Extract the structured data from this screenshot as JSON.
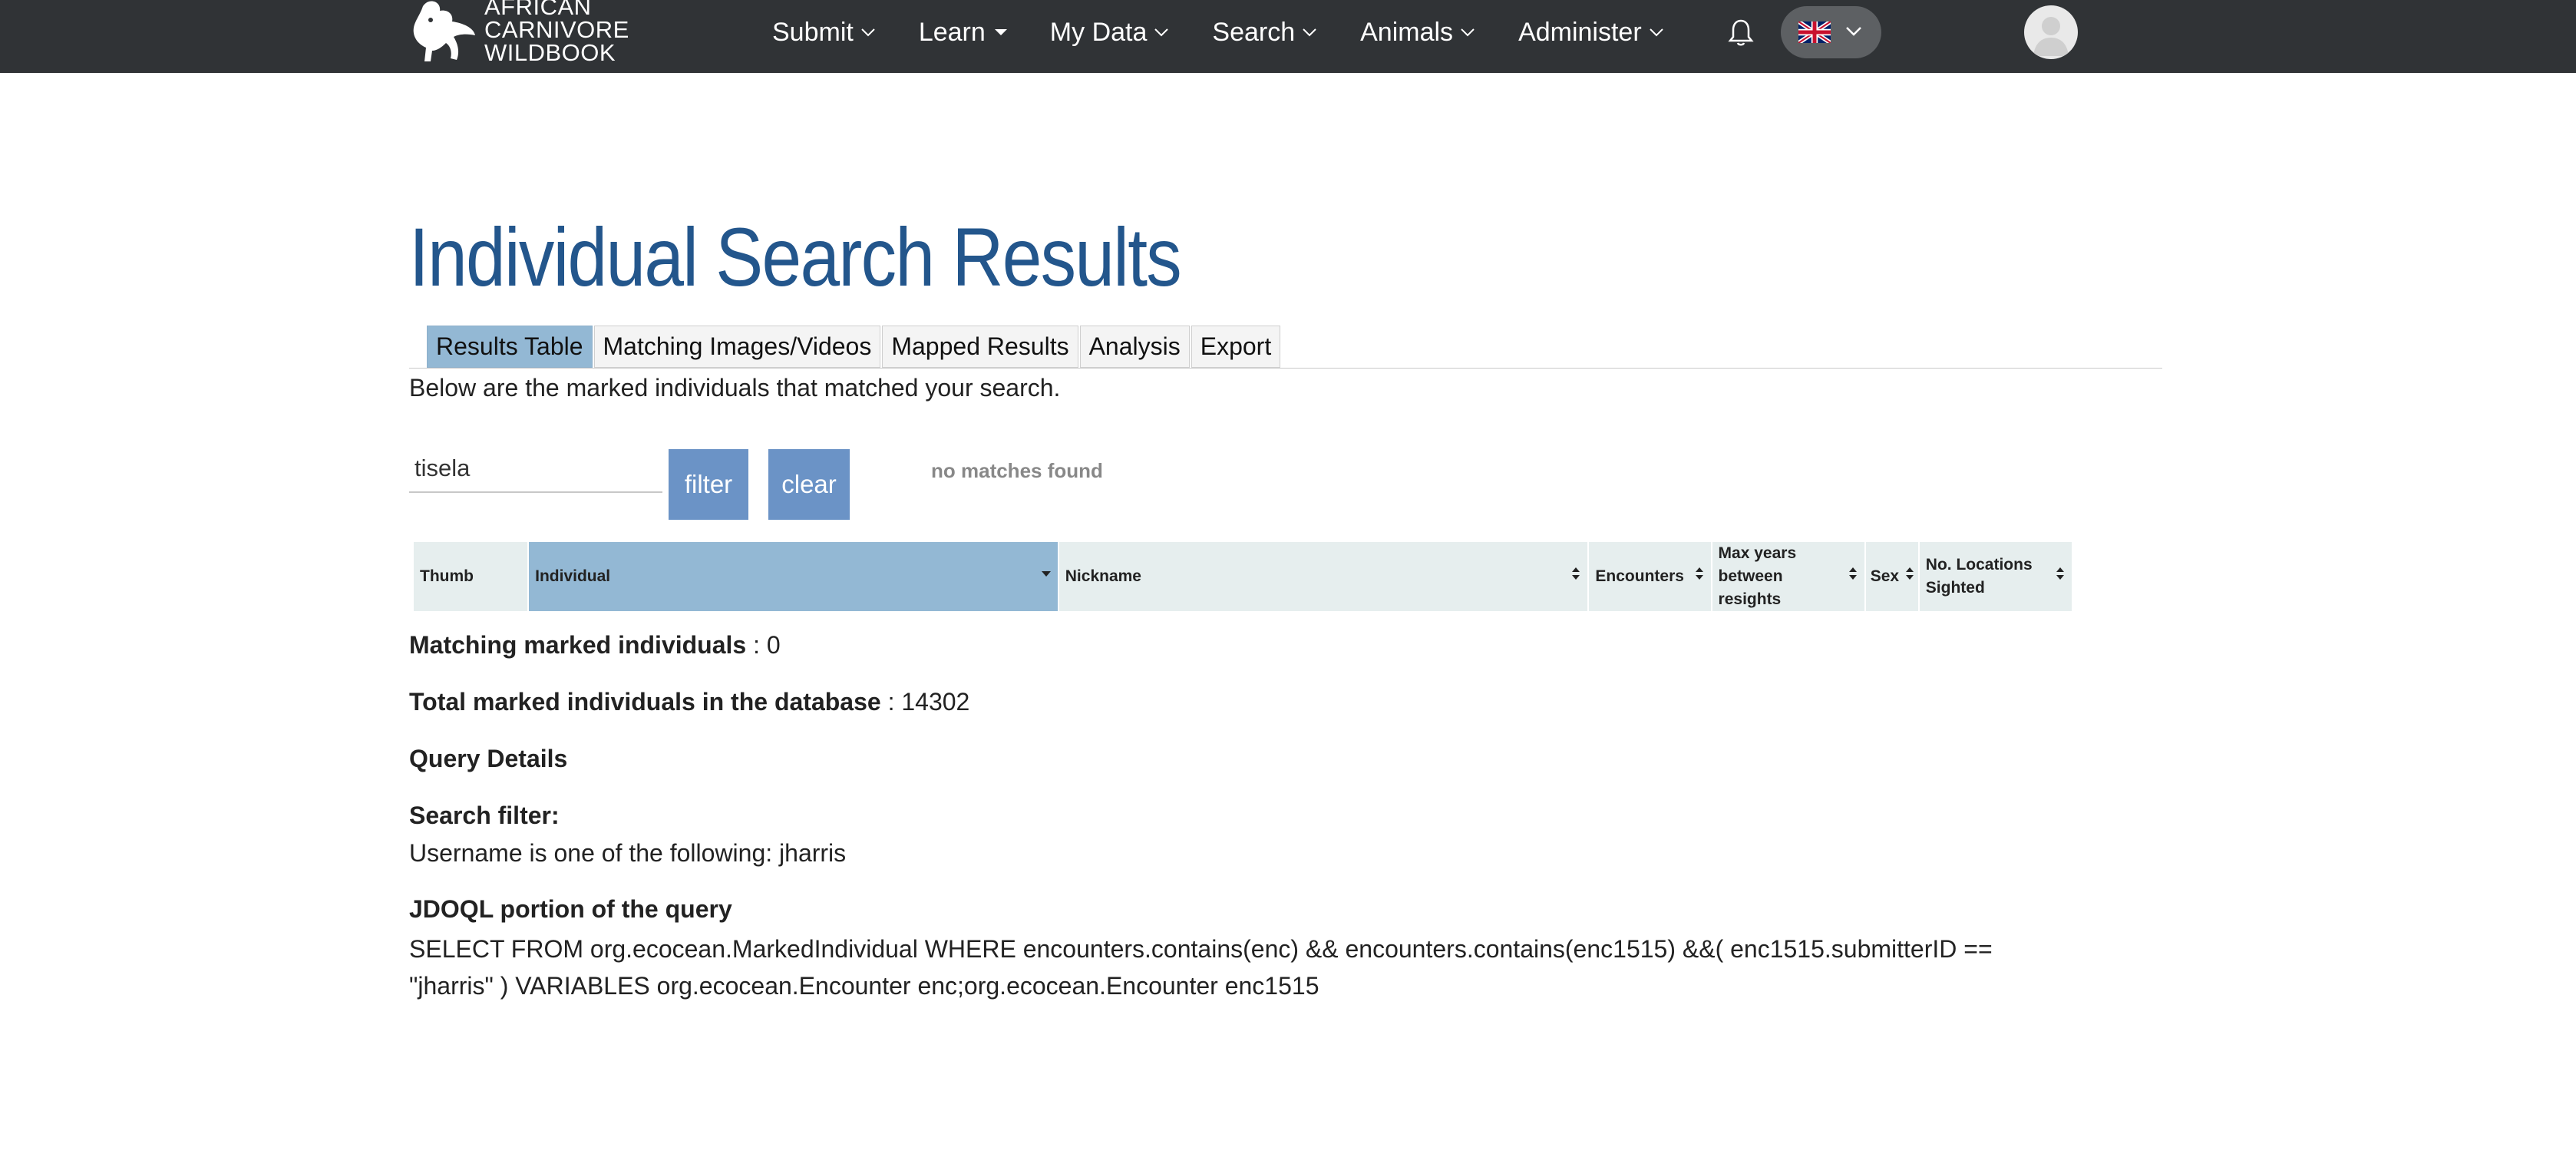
{
  "brand": {
    "line1": "AFRICAN",
    "line2": "CARNIVORE",
    "line3": "WILDBOOK"
  },
  "nav": {
    "items": [
      {
        "label": "Submit"
      },
      {
        "label": "Learn"
      },
      {
        "label": "My Data"
      },
      {
        "label": "Search"
      },
      {
        "label": "Animals"
      },
      {
        "label": "Administer"
      }
    ]
  },
  "page": {
    "title": "Individual Search Results",
    "intro": "Below are the marked individuals that matched your search."
  },
  "tabs": [
    {
      "label": "Results Table",
      "active": true
    },
    {
      "label": "Matching Images/Videos"
    },
    {
      "label": "Mapped Results"
    },
    {
      "label": "Analysis"
    },
    {
      "label": "Export"
    }
  ],
  "filter": {
    "value": "tisela",
    "filter_label": "filter",
    "clear_label": "clear",
    "status": "no matches found"
  },
  "table": {
    "columns": [
      {
        "label": "Thumb"
      },
      {
        "label": "Individual",
        "sorted": true
      },
      {
        "label": "Nickname"
      },
      {
        "label": "Encounters"
      },
      {
        "label": "Max years between resights"
      },
      {
        "label": "Sex"
      },
      {
        "label": "No. Locations Sighted"
      }
    ]
  },
  "stats": {
    "matching_label": "Matching marked individuals",
    "matching_value": " : 0",
    "total_label": "Total marked individuals in the database",
    "total_value": " : 14302"
  },
  "query": {
    "details_heading": "Query Details",
    "filter_heading": "Search filter:",
    "filter_text": "Username is one of the following: jharris",
    "jdoql_heading": "JDOQL portion of the query",
    "jdoql_text": "SELECT FROM org.ecocean.MarkedIndividual WHERE encounters.contains(enc) && encounters.contains(enc1515) &&( enc1515.submitterID == \"jharris\" ) VARIABLES org.ecocean.Encounter enc;org.ecocean.Encounter enc1515"
  },
  "colors": {
    "nav_bg": "#303336",
    "title": "#23568c",
    "active_tab": "#93b8d4",
    "button": "#6b93c6",
    "table_header": "#e6eeee"
  }
}
